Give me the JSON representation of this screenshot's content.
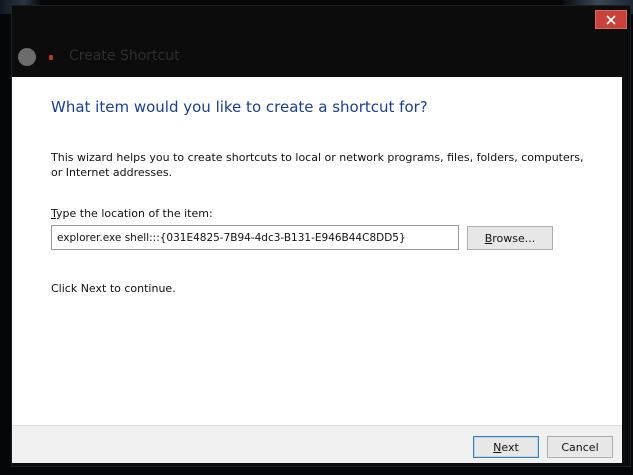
{
  "window": {
    "title": "Create Shortcut"
  },
  "wizard": {
    "heading": "What item would you like to create a shortcut for?",
    "intro": "This wizard helps you to create shortcuts to local or network programs, files, folders, computers, or Internet addresses.",
    "location_label_first": "T",
    "location_label_rest": "ype the location of the item:",
    "location_value": "explorer.exe shell:::{031E4825-7B94-4dc3-B131-E946B44C8DD5}",
    "browse_label_first": "B",
    "browse_label_rest": "rowse...",
    "continue_text": "Click Next to continue."
  },
  "footer": {
    "next_label_first": "N",
    "next_label_rest": "ext",
    "cancel_label": "Cancel"
  },
  "icons": {
    "close": "close-icon",
    "back": "back-arrow-icon",
    "app": "shortcut-app-icon"
  },
  "colors": {
    "heading": "#1a3f8f",
    "close_button": "#c7423a",
    "default_button_border": "#3c7fb1"
  }
}
